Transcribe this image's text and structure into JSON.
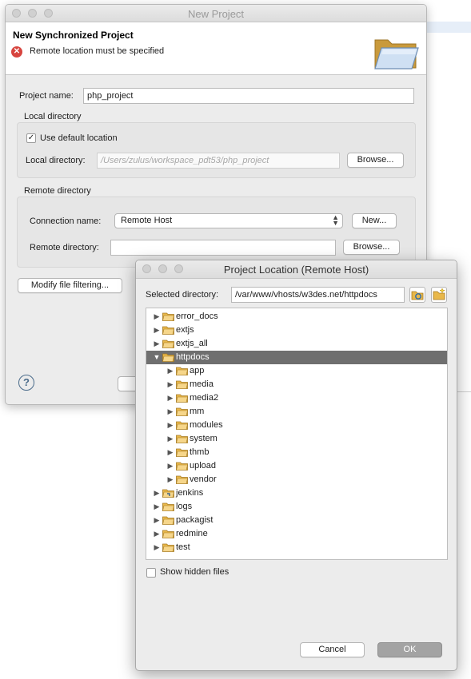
{
  "main_window": {
    "title": "New Project",
    "header_title": "New Synchronized Project",
    "error_message": "Remote location must be specified",
    "project_name_label": "Project name:",
    "project_name_value": "php_project",
    "local_group_label": "Local directory",
    "use_default_label": "Use default location",
    "use_default_checked": true,
    "local_dir_label": "Local directory:",
    "local_dir_value": "/Users/zulus/workspace_pdt53/php_project",
    "browse_label": "Browse...",
    "remote_group_label": "Remote directory",
    "connection_label": "Connection name:",
    "connection_value": "Remote Host",
    "new_label": "New...",
    "remote_dir_label": "Remote directory:",
    "remote_dir_value": "",
    "remote_browse_label": "Browse...",
    "modify_filter_label": "Modify file filtering...",
    "help_label": "?"
  },
  "dialog": {
    "title": "Project Location (Remote Host)",
    "selected_dir_label": "Selected directory:",
    "selected_dir_value": "/var/www/vhosts/w3des.net/httpdocs",
    "show_hidden_label": "Show hidden files",
    "show_hidden_checked": false,
    "cancel_label": "Cancel",
    "ok_label": "OK",
    "tree": [
      {
        "name": "error_docs",
        "level": 0,
        "expanded": false,
        "selected": false
      },
      {
        "name": "extjs",
        "level": 0,
        "expanded": false,
        "selected": false
      },
      {
        "name": "extjs_all",
        "level": 0,
        "expanded": false,
        "selected": false
      },
      {
        "name": "httpdocs",
        "level": 0,
        "expanded": true,
        "selected": true
      },
      {
        "name": "app",
        "level": 1,
        "expanded": false,
        "selected": false
      },
      {
        "name": "media",
        "level": 1,
        "expanded": false,
        "selected": false
      },
      {
        "name": "media2",
        "level": 1,
        "expanded": false,
        "selected": false
      },
      {
        "name": "mm",
        "level": 1,
        "expanded": false,
        "selected": false
      },
      {
        "name": "modules",
        "level": 1,
        "expanded": false,
        "selected": false
      },
      {
        "name": "system",
        "level": 1,
        "expanded": false,
        "selected": false
      },
      {
        "name": "thmb",
        "level": 1,
        "expanded": false,
        "selected": false
      },
      {
        "name": "upload",
        "level": 1,
        "expanded": false,
        "selected": false
      },
      {
        "name": "vendor",
        "level": 1,
        "expanded": false,
        "selected": false
      },
      {
        "name": "jenkins",
        "level": 0,
        "expanded": false,
        "selected": false,
        "link": true
      },
      {
        "name": "logs",
        "level": 0,
        "expanded": false,
        "selected": false
      },
      {
        "name": "packagist",
        "level": 0,
        "expanded": false,
        "selected": false
      },
      {
        "name": "redmine",
        "level": 0,
        "expanded": false,
        "selected": false
      },
      {
        "name": "test",
        "level": 0,
        "expanded": false,
        "selected": false
      }
    ]
  },
  "colors": {
    "error": "#d7453f",
    "selection": "#6f6f6f",
    "folder": "#e9b84a"
  }
}
